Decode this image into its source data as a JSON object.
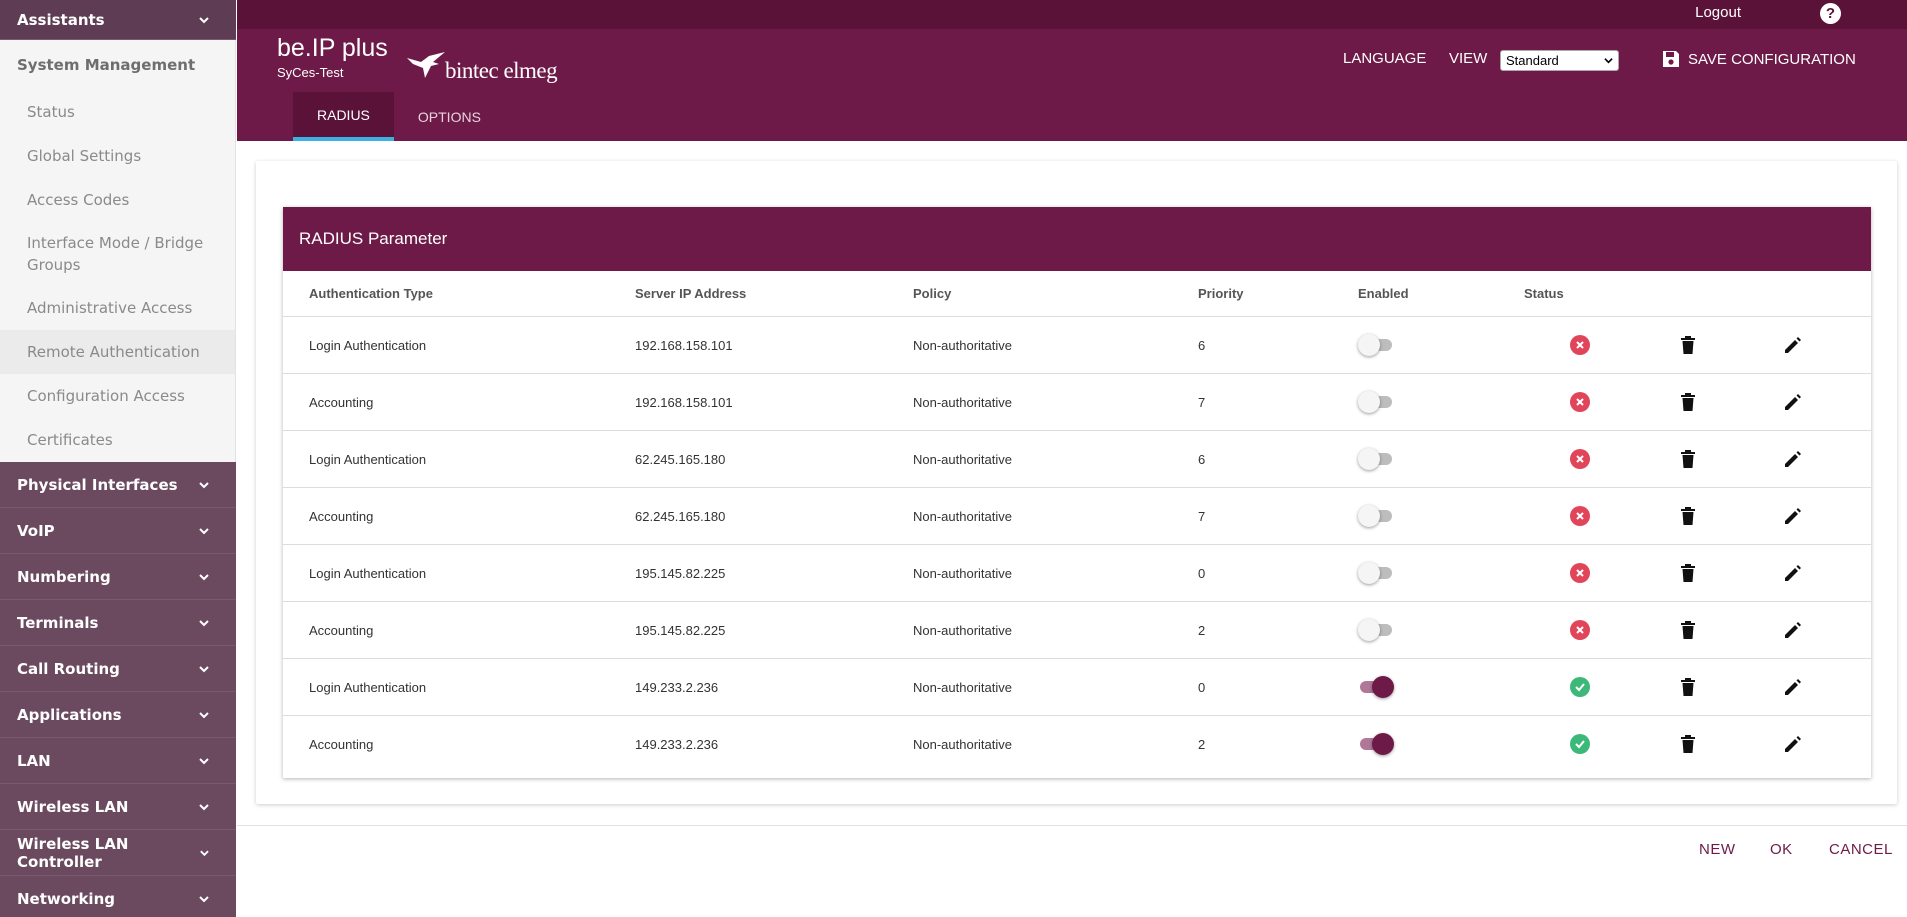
{
  "sidebar": {
    "assistants": "Assistants",
    "system_management": "System Management",
    "sub_items": [
      {
        "label": "Status"
      },
      {
        "label": "Global Settings"
      },
      {
        "label": "Access Codes"
      },
      {
        "label": "Interface Mode / Bridge Groups"
      },
      {
        "label": "Administrative Access"
      },
      {
        "label": "Remote Authentication"
      },
      {
        "label": "Configuration Access"
      },
      {
        "label": "Certificates"
      }
    ],
    "sections": [
      {
        "label": "Physical Interfaces"
      },
      {
        "label": "VoIP"
      },
      {
        "label": "Numbering"
      },
      {
        "label": "Terminals"
      },
      {
        "label": "Call Routing"
      },
      {
        "label": "Applications"
      },
      {
        "label": "LAN"
      },
      {
        "label": "Wireless LAN"
      },
      {
        "label": "Wireless LAN Controller"
      },
      {
        "label": "Networking"
      }
    ]
  },
  "header": {
    "logout": "Logout",
    "help": "?",
    "product": "be.IP plus",
    "device": "SyCes-Test",
    "logo_text": "bintec elmeg",
    "language": "LANGUAGE",
    "view": "VIEW",
    "view_value": "Standard",
    "save": "SAVE CONFIGURATION",
    "tabs": [
      {
        "label": "RADIUS"
      },
      {
        "label": "OPTIONS"
      }
    ]
  },
  "table": {
    "title": "RADIUS Parameter",
    "columns": [
      "Authentication Type",
      "Server IP Address",
      "Policy",
      "Priority",
      "Enabled",
      "Status"
    ],
    "rows": [
      {
        "type": "Login Authentication",
        "ip": "192.168.158.101",
        "policy": "Non-authoritative",
        "priority": "6",
        "enabled": false,
        "status": "error"
      },
      {
        "type": "Accounting",
        "ip": "192.168.158.101",
        "policy": "Non-authoritative",
        "priority": "7",
        "enabled": false,
        "status": "error"
      },
      {
        "type": "Login Authentication",
        "ip": "62.245.165.180",
        "policy": "Non-authoritative",
        "priority": "6",
        "enabled": false,
        "status": "error"
      },
      {
        "type": "Accounting",
        "ip": "62.245.165.180",
        "policy": "Non-authoritative",
        "priority": "7",
        "enabled": false,
        "status": "error"
      },
      {
        "type": "Login Authentication",
        "ip": "195.145.82.225",
        "policy": "Non-authoritative",
        "priority": "0",
        "enabled": false,
        "status": "error"
      },
      {
        "type": "Accounting",
        "ip": "195.145.82.225",
        "policy": "Non-authoritative",
        "priority": "2",
        "enabled": false,
        "status": "error"
      },
      {
        "type": "Login Authentication",
        "ip": "149.233.2.236",
        "policy": "Non-authoritative",
        "priority": "0",
        "enabled": true,
        "status": "ok"
      },
      {
        "type": "Accounting",
        "ip": "149.233.2.236",
        "policy": "Non-authoritative",
        "priority": "2",
        "enabled": true,
        "status": "ok"
      }
    ]
  },
  "footer": {
    "new": "NEW",
    "ok": "OK",
    "cancel": "CANCEL"
  },
  "colors": {
    "brand": "#6e1a48",
    "sidebar": "#6b4a60",
    "error": "#e0455a",
    "ok": "#3cb878"
  }
}
